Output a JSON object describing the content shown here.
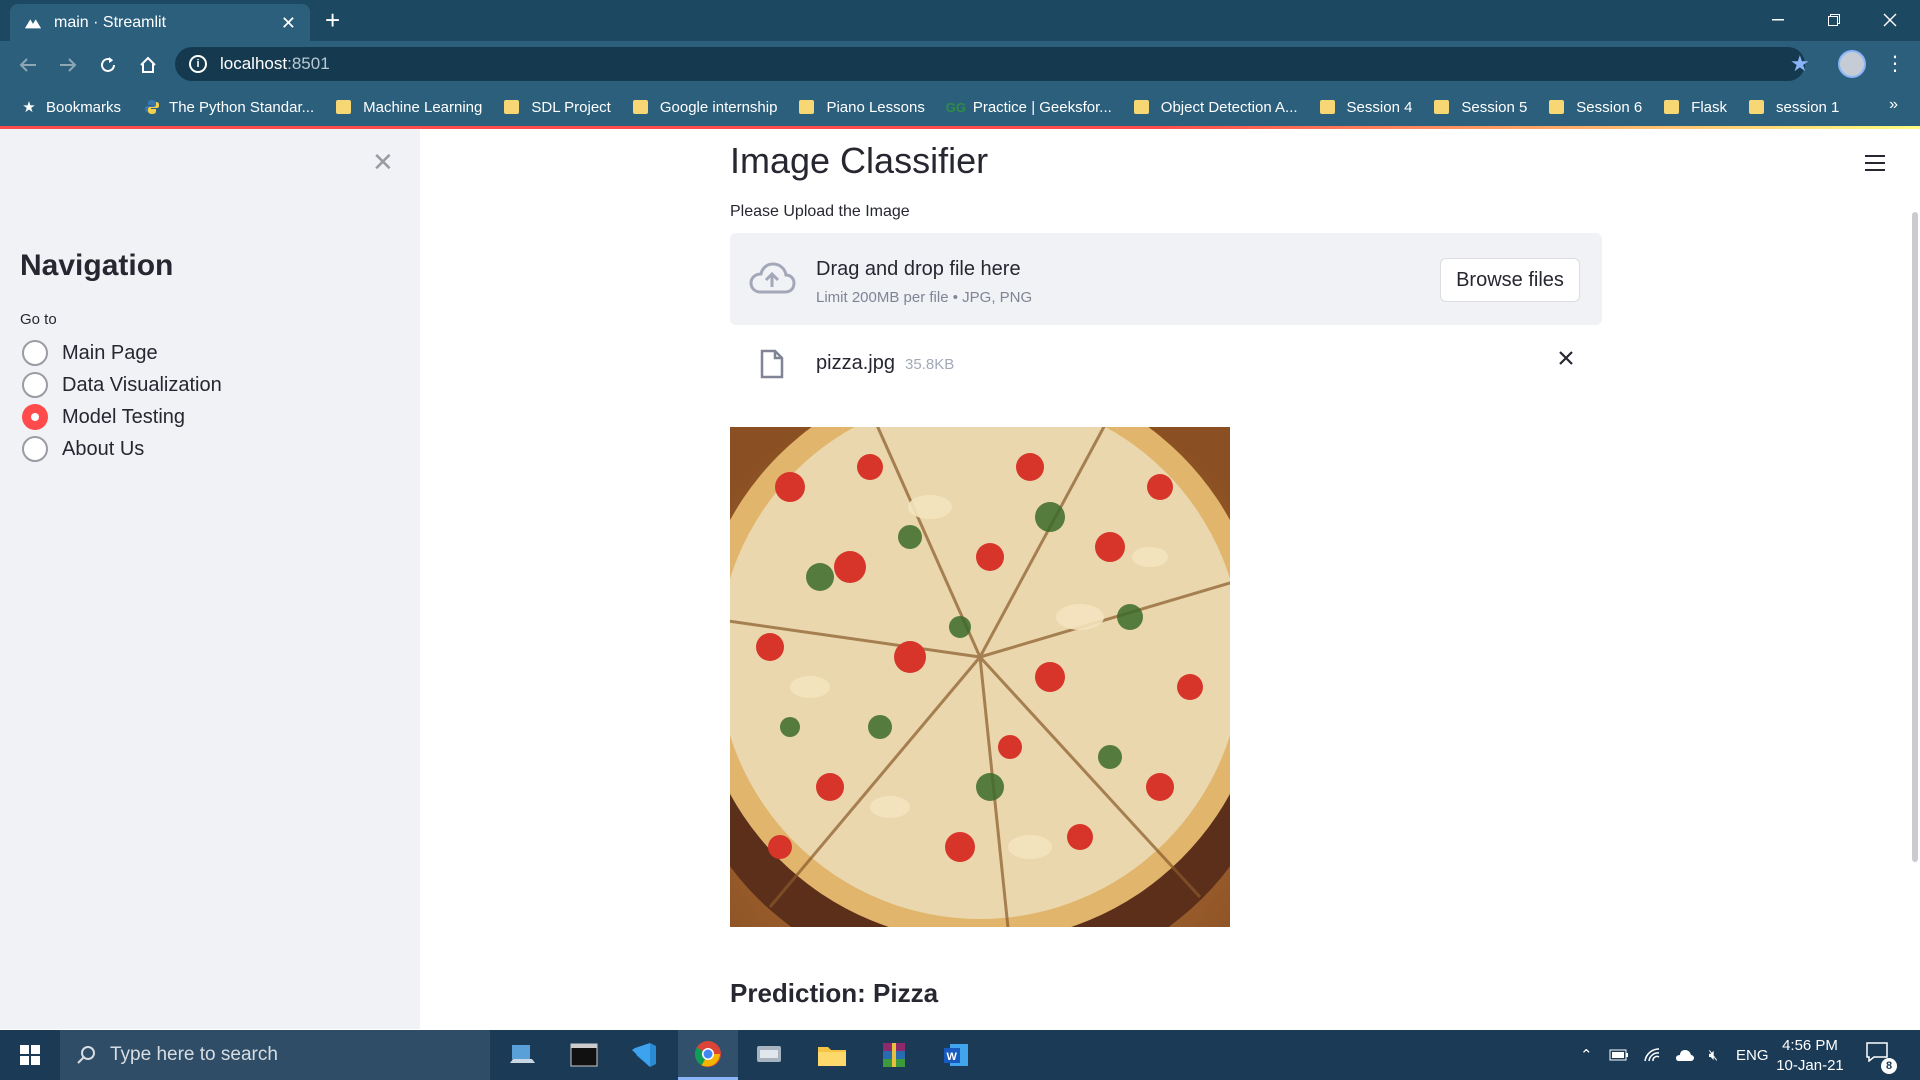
{
  "browser": {
    "tab_title": "main · Streamlit",
    "url_host": "localhost",
    "url_port": ":8501"
  },
  "bookmarks": [
    {
      "label": "Bookmarks",
      "icon": "star-icon"
    },
    {
      "label": "The Python Standar...",
      "icon": "python-icon"
    },
    {
      "label": "Machine Learning",
      "icon": "folder-icon"
    },
    {
      "label": "SDL Project",
      "icon": "folder-icon"
    },
    {
      "label": "Google internship",
      "icon": "folder-icon"
    },
    {
      "label": "Piano Lessons",
      "icon": "folder-icon"
    },
    {
      "label": "Practice | Geeksfor...",
      "icon": "geeksforgeeks-icon"
    },
    {
      "label": "Object Detection A...",
      "icon": "folder-icon"
    },
    {
      "label": "Session 4",
      "icon": "folder-icon"
    },
    {
      "label": "Session 5",
      "icon": "folder-icon"
    },
    {
      "label": "Session 6",
      "icon": "folder-icon"
    },
    {
      "label": "Flask",
      "icon": "folder-icon"
    },
    {
      "label": "session 1",
      "icon": "folder-icon"
    }
  ],
  "sidebar": {
    "title": "Navigation",
    "radio_label": "Go to",
    "options": [
      "Main Page",
      "Data Visualization",
      "Model Testing",
      "About Us"
    ],
    "selected": "Model Testing"
  },
  "main": {
    "title": "Image Classifier",
    "upload_label": "Please Upload the Image",
    "dropzone_text": "Drag and drop file here",
    "dropzone_limit": "Limit 200MB per file • JPG, PNG",
    "browse_label": "Browse files",
    "file_name": "pizza.jpg",
    "file_size": "35.8KB",
    "prediction": "Prediction: Pizza"
  },
  "taskbar": {
    "search_placeholder": "Type here to search",
    "language": "ENG",
    "time": "4:56 PM",
    "date": "10-Jan-21",
    "notification_count": "8"
  },
  "colors": {
    "accent": "#ff4b4b",
    "sidebar_bg": "#f0f2f6",
    "browser_frame": "#2b5f7c"
  }
}
